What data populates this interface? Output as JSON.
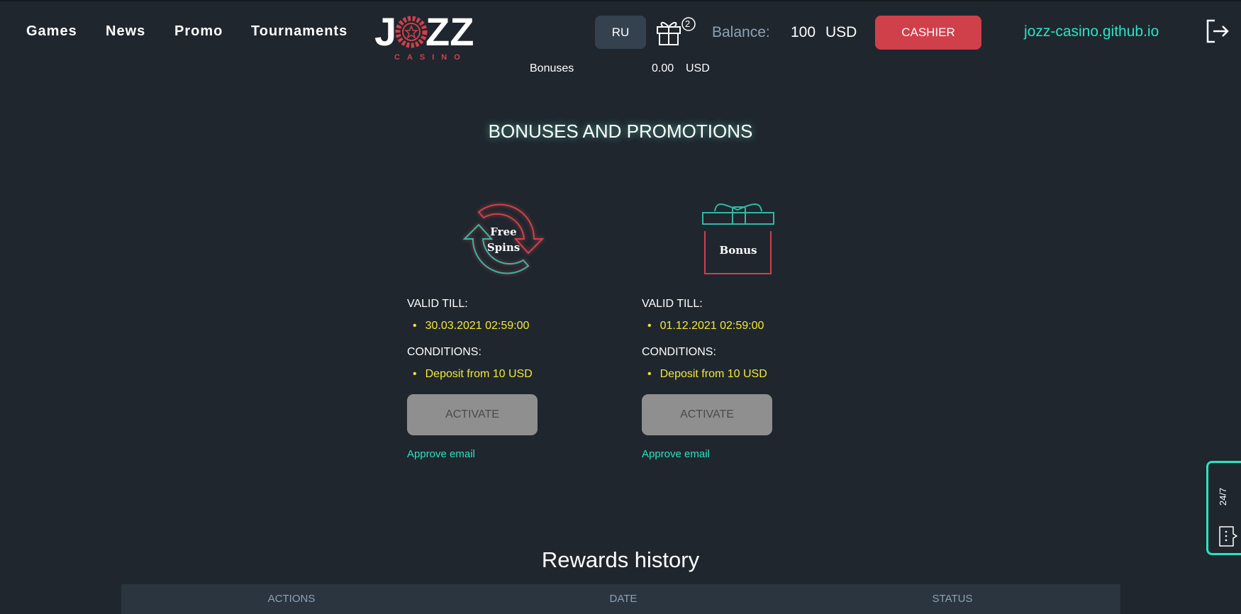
{
  "nav": {
    "items": [
      "Games",
      "News",
      "Promo",
      "Tournaments"
    ]
  },
  "logo": {
    "text": "JOZZ",
    "subtitle": "CASINO"
  },
  "header": {
    "language": "RU",
    "gift_count": "2",
    "balance_label": "Balance:",
    "balance_value": "100",
    "balance_currency": "USD",
    "cashier_label": "CASHIER",
    "site_link": "jozz-casino.github.io"
  },
  "bonuses_row": {
    "label": "Bonuses",
    "value": "0.00",
    "currency": "USD"
  },
  "page_title": "BONUSES AND PROMOTIONS",
  "cards": [
    {
      "icon_text_1": "Free",
      "icon_text_2": "Spins",
      "valid_label": "VALID TILL:",
      "valid_value": "30.03.2021 02:59:00",
      "conditions_label": "CONDITIONS:",
      "condition": "Deposit from 10 USD",
      "button": "ACTIVATE",
      "link": "Approve email"
    },
    {
      "icon_text_1": "Bonus",
      "valid_label": "VALID TILL:",
      "valid_value": "01.12.2021 02:59:00",
      "conditions_label": "CONDITIONS:",
      "condition": "Deposit from 10 USD",
      "button": "ACTIVATE",
      "link": "Approve email"
    }
  ],
  "rewards": {
    "title": "Rewards history",
    "columns": [
      "ACTIONS",
      "DATE",
      "STATUS"
    ]
  },
  "support": {
    "label": "24/7"
  },
  "colors": {
    "background": "#1f262e",
    "accent_teal": "#2be3c0",
    "accent_red": "#d0404a",
    "highlight_yellow": "#f2e83a"
  }
}
